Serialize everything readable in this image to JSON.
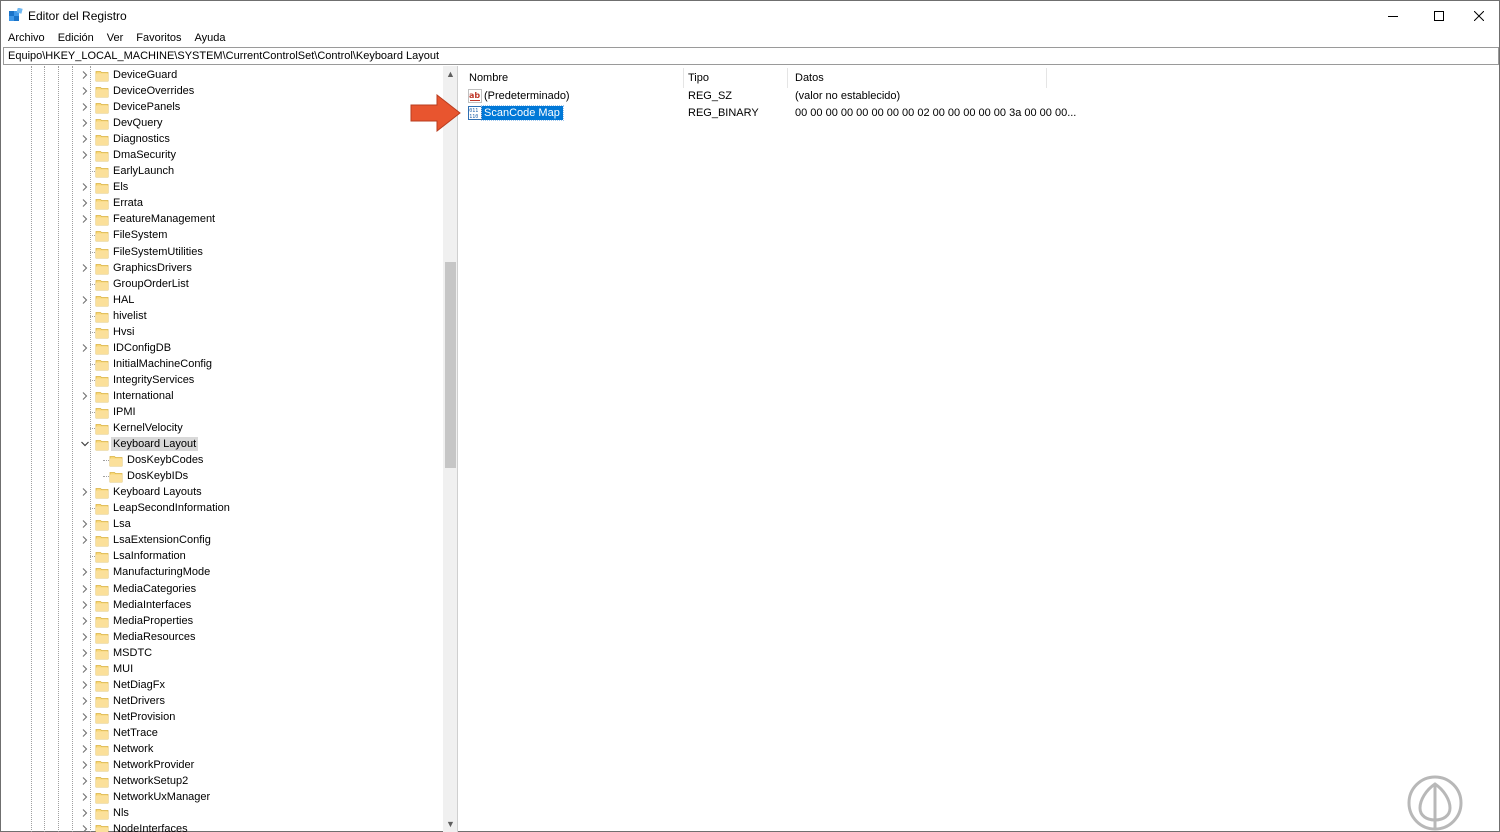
{
  "window": {
    "title": "Editor del Registro",
    "controls": {
      "minimize": "minimize-icon",
      "maximize": "maximize-icon",
      "close": "close-icon"
    }
  },
  "menu": [
    "Archivo",
    "Edición",
    "Ver",
    "Favoritos",
    "Ayuda"
  ],
  "address": "Equipo\\HKEY_LOCAL_MACHINE\\SYSTEM\\CurrentControlSet\\Control\\Keyboard Layout",
  "tree": {
    "items": [
      {
        "label": "DeviceGuard",
        "expandable": true
      },
      {
        "label": "DeviceOverrides",
        "expandable": true
      },
      {
        "label": "DevicePanels",
        "expandable": true
      },
      {
        "label": "DevQuery",
        "expandable": true
      },
      {
        "label": "Diagnostics",
        "expandable": true
      },
      {
        "label": "DmaSecurity",
        "expandable": true
      },
      {
        "label": "EarlyLaunch",
        "expandable": false
      },
      {
        "label": "Els",
        "expandable": true
      },
      {
        "label": "Errata",
        "expandable": true
      },
      {
        "label": "FeatureManagement",
        "expandable": true
      },
      {
        "label": "FileSystem",
        "expandable": false
      },
      {
        "label": "FileSystemUtilities",
        "expandable": false
      },
      {
        "label": "GraphicsDrivers",
        "expandable": true
      },
      {
        "label": "GroupOrderList",
        "expandable": false
      },
      {
        "label": "HAL",
        "expandable": true
      },
      {
        "label": "hivelist",
        "expandable": false
      },
      {
        "label": "Hvsi",
        "expandable": false
      },
      {
        "label": "IDConfigDB",
        "expandable": true
      },
      {
        "label": "InitialMachineConfig",
        "expandable": false
      },
      {
        "label": "IntegrityServices",
        "expandable": false
      },
      {
        "label": "International",
        "expandable": true
      },
      {
        "label": "IPMI",
        "expandable": false
      },
      {
        "label": "KernelVelocity",
        "expandable": false
      },
      {
        "label": "Keyboard Layout",
        "expandable": true,
        "expanded": true,
        "selected": true
      },
      {
        "label": "DosKeybCodes",
        "child": true
      },
      {
        "label": "DosKeybIDs",
        "child": true
      },
      {
        "label": "Keyboard Layouts",
        "expandable": true
      },
      {
        "label": "LeapSecondInformation",
        "expandable": false
      },
      {
        "label": "Lsa",
        "expandable": true
      },
      {
        "label": "LsaExtensionConfig",
        "expandable": true
      },
      {
        "label": "LsaInformation",
        "expandable": false
      },
      {
        "label": "ManufacturingMode",
        "expandable": true
      },
      {
        "label": "MediaCategories",
        "expandable": true
      },
      {
        "label": "MediaInterfaces",
        "expandable": true
      },
      {
        "label": "MediaProperties",
        "expandable": true
      },
      {
        "label": "MediaResources",
        "expandable": true
      },
      {
        "label": "MSDTC",
        "expandable": true
      },
      {
        "label": "MUI",
        "expandable": true
      },
      {
        "label": "NetDiagFx",
        "expandable": true
      },
      {
        "label": "NetDrivers",
        "expandable": true
      },
      {
        "label": "NetProvision",
        "expandable": true
      },
      {
        "label": "NetTrace",
        "expandable": true
      },
      {
        "label": "Network",
        "expandable": true
      },
      {
        "label": "NetworkProvider",
        "expandable": true
      },
      {
        "label": "NetworkSetup2",
        "expandable": true
      },
      {
        "label": "NetworkUxManager",
        "expandable": true
      },
      {
        "label": "Nls",
        "expandable": true
      },
      {
        "label": "NodeInterfaces",
        "expandable": true
      }
    ]
  },
  "values": {
    "columns": {
      "name": "Nombre",
      "type": "Tipo",
      "data": "Datos"
    },
    "rows": [
      {
        "name": "(Predeterminado)",
        "type": "REG_SZ",
        "data": "(valor no establecido)",
        "icon": "string-value-icon"
      },
      {
        "name": "ScanCode Map",
        "type": "REG_BINARY",
        "data": "00 00 00 00 00 00 00 00 02 00 00 00 00 00 3a 00 00 00...",
        "icon": "binary-value-icon",
        "selected": true
      }
    ]
  },
  "colors": {
    "selection": "#0078d7",
    "folder": "#f8d775",
    "arrow": "#e8552f",
    "watermark": "#b8b8b8"
  }
}
